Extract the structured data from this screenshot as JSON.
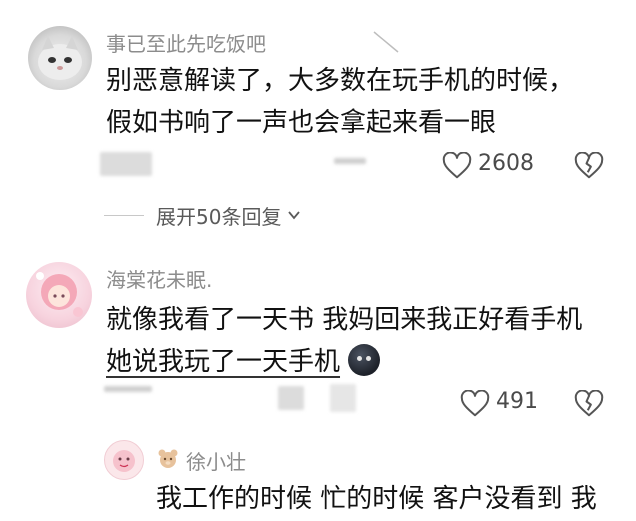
{
  "comments": [
    {
      "username": "事已至此先吃饭吧",
      "lines": [
        "别恶意解读了，大多数在玩手机的时候，",
        "假如书响了一声也会拿起来看一眼"
      ],
      "likes": "2608",
      "expand_label": "展开50条回复"
    },
    {
      "username": "海棠花未眠.",
      "lines": [
        "就像我看了一天书 我妈回来我正好看手机",
        "她说我玩了一天手机"
      ],
      "likes": "491"
    },
    {
      "username": "徐小壮",
      "lines": [
        "我工作的时候 忙的时候 客户没看到 我"
      ]
    }
  ],
  "icons": {
    "like": "heart-outline-icon",
    "dislike": "broken-heart-icon",
    "expand": "chevron-down-icon",
    "emoji": "dark-face-emoji-icon",
    "badge": "bear-badge-icon"
  }
}
